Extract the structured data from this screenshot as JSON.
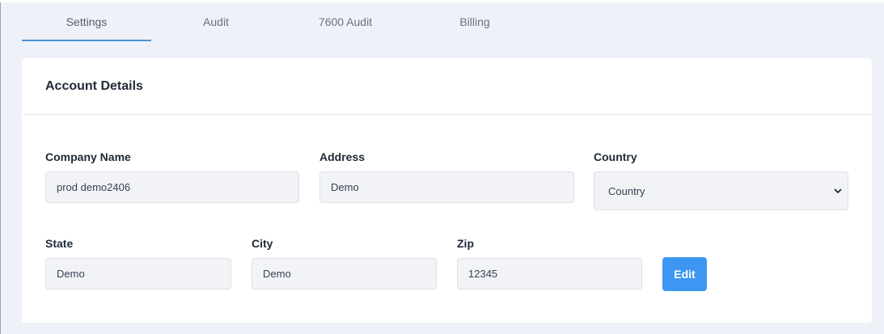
{
  "tabs": [
    {
      "label": "Settings",
      "active": true
    },
    {
      "label": "Audit",
      "active": false
    },
    {
      "label": "7600 Audit",
      "active": false
    },
    {
      "label": "Billing",
      "active": false
    }
  ],
  "card": {
    "title": "Account Details"
  },
  "form": {
    "company_name": {
      "label": "Company Name",
      "value": "prod demo2406"
    },
    "address": {
      "label": "Address",
      "value": "Demo"
    },
    "country": {
      "label": "Country",
      "value": "Country"
    },
    "state": {
      "label": "State",
      "value": "Demo"
    },
    "city": {
      "label": "City",
      "value": "Demo"
    },
    "zip": {
      "label": "Zip",
      "value": "12345"
    },
    "edit_label": "Edit"
  },
  "colors": {
    "accent": "#3d97f2",
    "tab_underline": "#4b93d6",
    "background": "#eef1f8",
    "input_bg": "#f1f3f7"
  },
  "icons": {
    "select_arrow": "chevron-down-icon"
  }
}
